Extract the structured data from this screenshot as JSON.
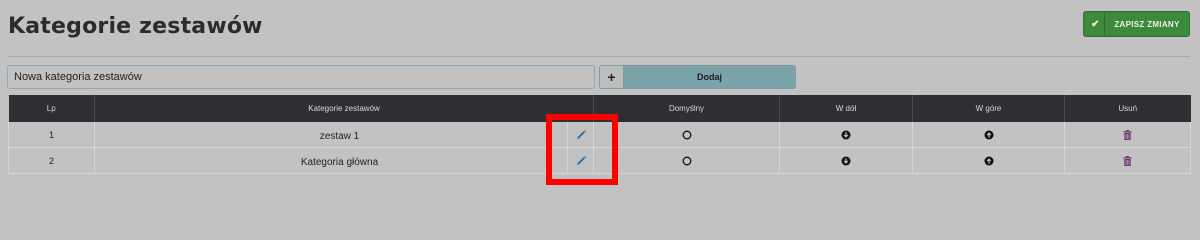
{
  "header": {
    "title": "Kategorie zestawów",
    "save_label": "ZAPISZ ZMIANY",
    "save_icon": "check-icon"
  },
  "new_category": {
    "value": "Nowa kategoria zestawów",
    "plus_label": "+",
    "add_label": "Dodaj"
  },
  "table": {
    "columns": [
      "Lp",
      "Kategorie zestawów",
      "Domyślny",
      "W dół",
      "W góre",
      "Usuń"
    ],
    "rows": [
      {
        "lp": "1",
        "name": "zestaw 1"
      },
      {
        "lp": "2",
        "name": "Kategoria główna"
      }
    ]
  },
  "icons": {
    "edit": "pencil-icon",
    "default": "radio-circle-icon",
    "down": "arrow-down-circle-icon",
    "up": "arrow-up-circle-icon",
    "delete": "trash-icon"
  },
  "colors": {
    "save_button": "#3d8a3d",
    "add_button": "#7ba3a9",
    "table_header": "#2e2f33",
    "pencil": "#2a6f9e",
    "trash": "#6b3b6b",
    "highlight": "#ff0000"
  }
}
